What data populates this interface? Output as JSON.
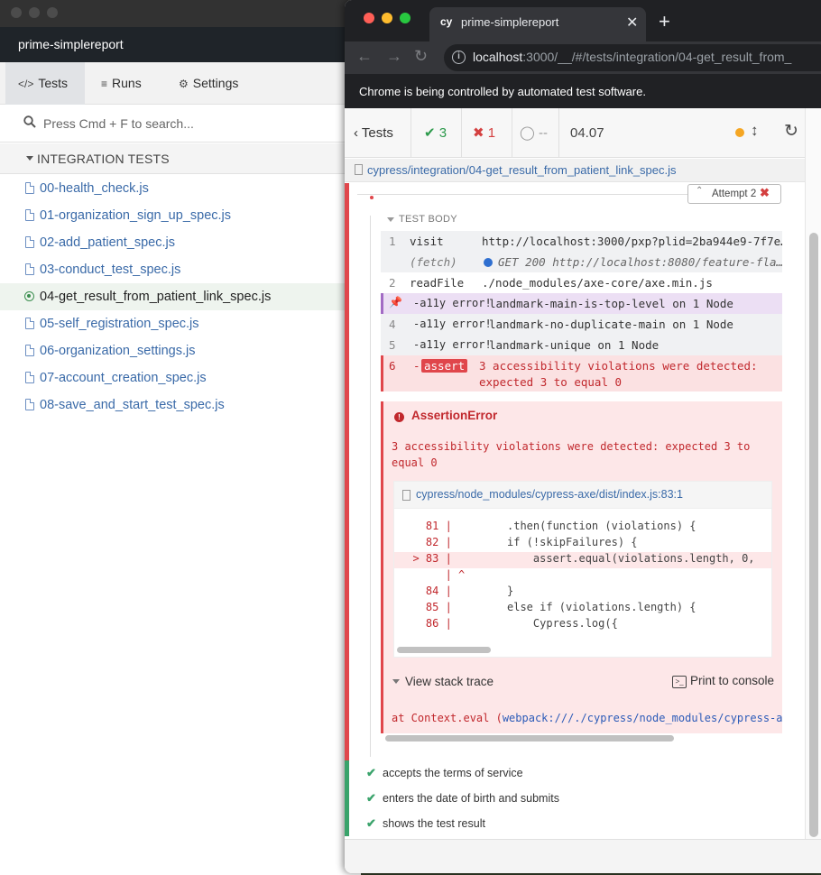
{
  "runner": {
    "title": "prime-simplereport",
    "tabs": [
      {
        "icon": "</>",
        "label": "Tests"
      },
      {
        "icon": "≡",
        "label": "Runs"
      },
      {
        "icon": "⚙",
        "label": "Settings"
      }
    ],
    "search_placeholder": "Press Cmd + F to search...",
    "folder": "INTEGRATION TESTS",
    "specs": [
      "00-health_check.js",
      "01-organization_sign_up_spec.js",
      "02-add_patient_spec.js",
      "03-conduct_test_spec.js",
      "04-get_result_from_patient_link_spec.js",
      "05-self_registration_spec.js",
      "06-organization_settings.js",
      "07-account_creation_spec.js",
      "08-save_and_start_test_spec.js"
    ],
    "running_spec_index": 4
  },
  "chrome": {
    "tab_favicon": "cy",
    "tab_title": "prime-simplereport",
    "url_host": "localhost",
    "url_rest": ":3000/__/#/tests/integration/04-get_result_from_",
    "automation_notice": "Chrome is being controlled by automated test software."
  },
  "reporter": {
    "tests_button": "Tests",
    "passed": "3",
    "failed": "1",
    "pending": "--",
    "duration": "04.07",
    "spec_path": "cypress/integration/04-get_result_from_patient_link_spec.js",
    "attempt": "Attempt 2",
    "test_body_label": "TEST BODY",
    "commands": [
      {
        "num": "1",
        "name": "visit",
        "msg": "http://localhost:3000/pxp?plid=2ba944e9-7f7e…"
      },
      {
        "num": "",
        "name": "(fetch)",
        "msg": "GET 200 http://localhost:8080/feature-fla…"
      },
      {
        "num": "2",
        "name": "readFile",
        "msg": "./node_modules/axe-core/axe.min.js"
      },
      {
        "num": "",
        "name": "-a11y error!",
        "msg": "landmark-main-is-top-level on 1 Node"
      },
      {
        "num": "4",
        "name": "-a11y error!",
        "msg": "landmark-no-duplicate-main on 1 Node"
      },
      {
        "num": "5",
        "name": "-a11y error!",
        "msg": "landmark-unique on 1 Node"
      }
    ],
    "assert_cmd": {
      "num": "6",
      "prefix": "-",
      "badge": "assert",
      "line1": "3 accessibility violations were detected:",
      "line2": "expected 3  to equal 0"
    },
    "error": {
      "name": "AssertionError",
      "message": "3 accessibility violations were detected: expected 3 to equal 0",
      "code_path": "cypress/node_modules/cypress-axe/dist/index.js:83:1",
      "code_lines": [
        {
          "gutter": "    81 |",
          "src": ".then(function (violations) {"
        },
        {
          "gutter": "    82 |",
          "src": "if (!skipFailures) {"
        },
        {
          "gutter": "  > 83 |",
          "src": "    assert.equal(violations.length, 0,"
        },
        {
          "gutter": "       | ^",
          "src": ""
        },
        {
          "gutter": "    84 |",
          "src": "}"
        },
        {
          "gutter": "    85 |",
          "src": "else if (violations.length) {"
        },
        {
          "gutter": "    86 |",
          "src": "    Cypress.log({"
        }
      ],
      "stack_toggle": "View stack trace",
      "print_console": "Print to console",
      "stack_prefix": "at Context.eval (",
      "stack_link": "webpack:///./cypress/node_modules/cypress-a"
    },
    "passed_tests": [
      "accepts the terms of service",
      "enters the date of birth and submits",
      "shows the test result"
    ]
  },
  "colors": {
    "passed": "#2d9a4c",
    "failed": "#d44040",
    "link": "#3a6aa8",
    "error_bg": "#fde7e8",
    "running_indicator": "#f5a623"
  }
}
